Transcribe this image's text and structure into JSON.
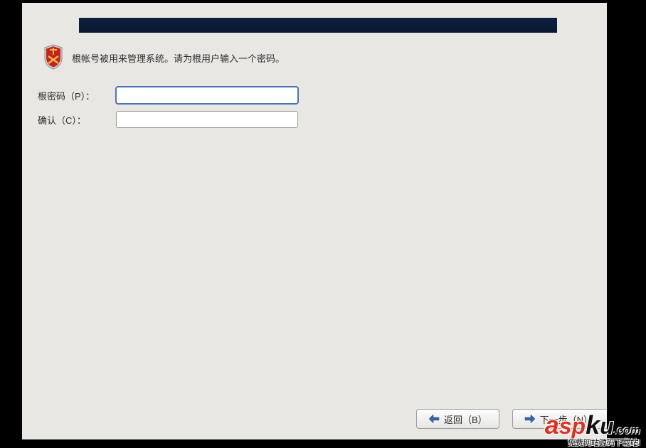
{
  "info": {
    "text": "根帐号被用来管理系统。请为根用户输入一个密码。"
  },
  "form": {
    "password_label": "根密码（P）：",
    "confirm_label": "确认（C）：",
    "password_value": "",
    "confirm_value": ""
  },
  "buttons": {
    "back_label": "返回（B）",
    "next_label": "下一步（N）"
  },
  "watermark": {
    "brand_a": "a",
    "brand_s": "s",
    "brand_p": "p",
    "brand_k": "k",
    "brand_u": "u",
    "dot": ".",
    "tld": "com",
    "tagline": "免费网站源码下载站!"
  }
}
